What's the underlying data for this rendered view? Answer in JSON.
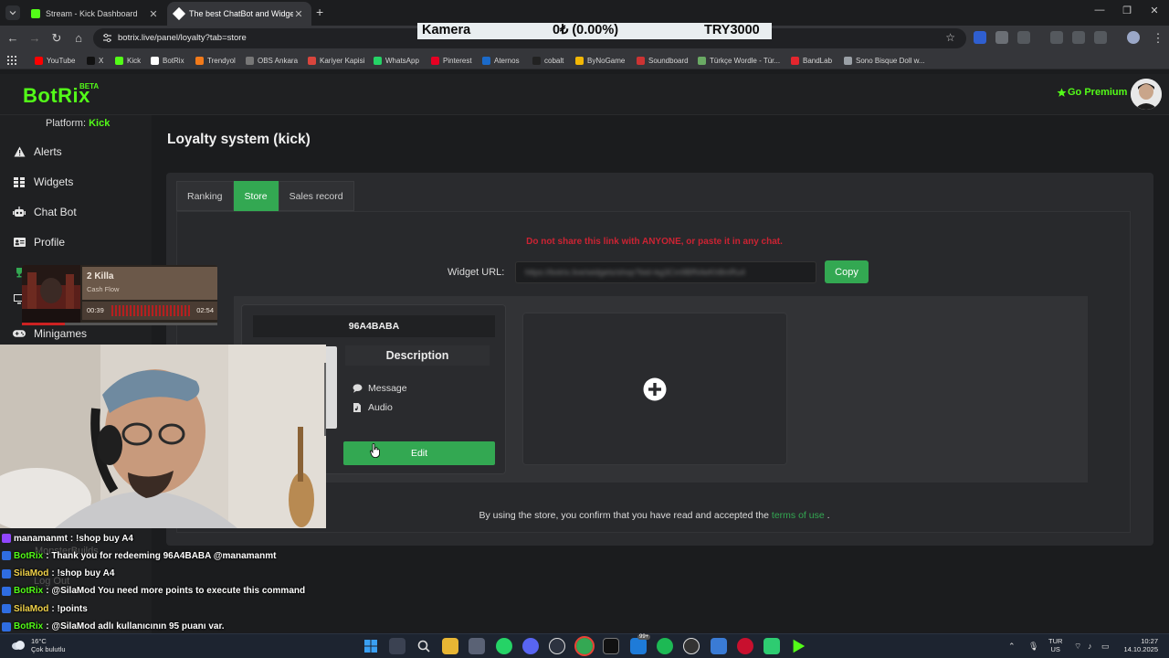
{
  "browser": {
    "tabs": [
      {
        "title": "Stream - Kick Dashboard",
        "active": false
      },
      {
        "title": "The best ChatBot and Widgets",
        "active": true
      }
    ],
    "new_tab": "+",
    "url": "botrix.live/panel/loyalty?tab=store",
    "ticker": {
      "name": "Kamera",
      "value": "0₺ (0.00%)",
      "target": "TRY3000"
    },
    "bookmarks": [
      "YouTube",
      "X",
      "Kick",
      "BotRix",
      "Trendyol",
      "OBS Ankara",
      "Kariyer Kapisi",
      "WhatsApp",
      "Pinterest",
      "Aternos",
      "cobalt",
      "ByNoGame",
      "Soundboard",
      "Türkçe Wordle - Tür...",
      "BandLab",
      "Sono Bisque Doll w..."
    ],
    "bookmark_colors": [
      "#ff0000",
      "#111111",
      "#53fc18",
      "#ffffff",
      "#f27a1a",
      "#777777",
      "#d9453d",
      "#25d366",
      "#e60023",
      "#1b6ac9",
      "#222222",
      "#f2b705",
      "#cc3333",
      "#6aaa64",
      "#e3262e",
      "#9aa0a6"
    ]
  },
  "app": {
    "logo": "BotRix",
    "logo_badge": "BETA",
    "premium": "Go Premium",
    "platform_label": "Platform:",
    "platform": "Kick",
    "nav": [
      {
        "label": "Alerts",
        "icon": "warning-icon"
      },
      {
        "label": "Widgets",
        "icon": "grid-icon"
      },
      {
        "label": "Chat Bot",
        "icon": "robot-icon"
      },
      {
        "label": "Profile",
        "icon": "id-card-icon"
      },
      {
        "label": "Minigames",
        "icon": "gamepad-icon"
      }
    ],
    "page_title": "Loyalty system (kick)",
    "tabs": [
      "Ranking",
      "Store",
      "Sales record"
    ],
    "active_tab": "Store",
    "warning": "Do not share this link with ANYONE, or paste it in any chat.",
    "widget_url_label": "Widget URL:",
    "widget_url": "https://botrix.live/widgets/shop?bid=kg3Cm9BfN4eKh8mRu4",
    "copy_label": "Copy",
    "item": {
      "name": "96A4BABA",
      "description_title": "Description",
      "lines": [
        "Message",
        "Audio"
      ],
      "edit_label": "Edit"
    },
    "add_icon": "plus-circle-icon",
    "footer_prefix": "By using the store, you confirm that you have read and accepted the",
    "footer_link": "terms of use",
    "footer_suffix": ".",
    "accent": "#33a852",
    "warning_color": "#cc2333",
    "brand": "#53fc18"
  },
  "overlay": {
    "player": {
      "title": "2 Killa",
      "artist": "Cash Flow",
      "current": "00:39",
      "total": "02:54",
      "progress": 0.22
    },
    "hidden_sidebar": [
      "MonsterBuilds",
      "Log Out"
    ],
    "chat": [
      {
        "user": "manamanmt",
        "color": "#ffffff",
        "text": ": !shop buy A4",
        "badge": "#9146ff"
      },
      {
        "user": "BotRix",
        "color": "#53fc18",
        "text": ": Thank you for redeeming 96A4BABA @manamanmt",
        "badge": "#2f6de1"
      },
      {
        "user": "SilaMod",
        "color": "#f0d24a",
        "text": ": !shop buy A4",
        "badge": "#2f6de1"
      },
      {
        "user": "BotRix",
        "color": "#53fc18",
        "text": ": @SilaMod You need more points to execute this command",
        "badge": "#2f6de1"
      },
      {
        "user": "SilaMod",
        "color": "#f0d24a",
        "text": ": !points",
        "badge": "#2f6de1"
      },
      {
        "user": "BotRix",
        "color": "#53fc18",
        "text": ": @SilaMod adlı kullanıcının 95 puanı var.",
        "badge": "#2f6de1"
      }
    ]
  },
  "taskbar": {
    "weather_temp": "16°C",
    "weather_desc": "Çok bulutlu",
    "lang_top": "TUR",
    "lang_bottom": "US",
    "time": "10:27",
    "date": "14.10.2025",
    "badges": [
      "99+"
    ]
  }
}
